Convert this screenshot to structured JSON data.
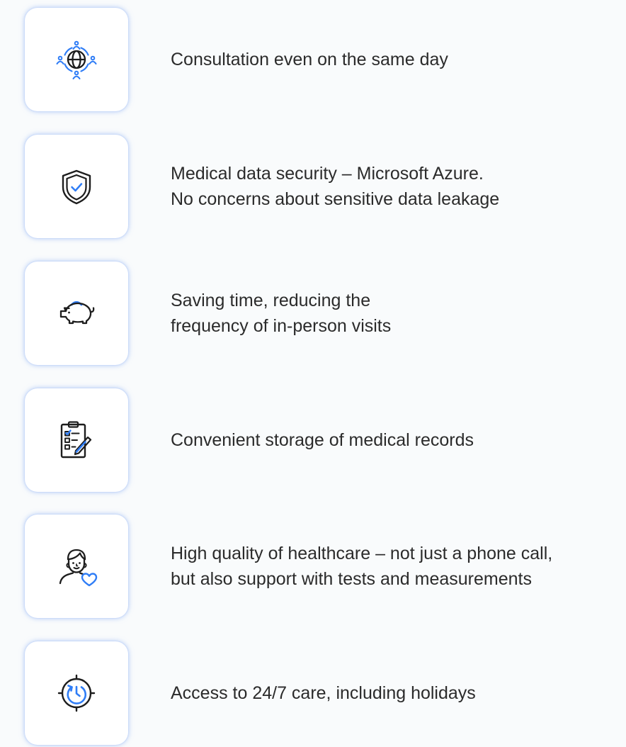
{
  "colors": {
    "background": "#f9fbfc",
    "tile": "#ffffff",
    "text": "#2b2b2b",
    "icon_dark": "#1d1d1d",
    "icon_accent": "#2f7df6"
  },
  "features": [
    {
      "icon": "globe-people-icon",
      "lines": [
        "Consultation even on the same day"
      ]
    },
    {
      "icon": "shield-check-icon",
      "lines": [
        "Medical data security – Microsoft Azure.",
        "No concerns about sensitive data leakage"
      ]
    },
    {
      "icon": "piggy-bank-icon",
      "lines": [
        "Saving time, reducing the",
        "frequency of in-person visits"
      ]
    },
    {
      "icon": "clipboard-records-icon",
      "lines": [
        "Convenient storage of medical records"
      ]
    },
    {
      "icon": "doctor-heart-icon",
      "lines": [
        "High quality of healthcare – not just a phone call,",
        "but also support with tests and measurements"
      ]
    },
    {
      "icon": "clock-cycle-icon",
      "lines": [
        "Access to 24/7 care, including holidays"
      ]
    }
  ]
}
